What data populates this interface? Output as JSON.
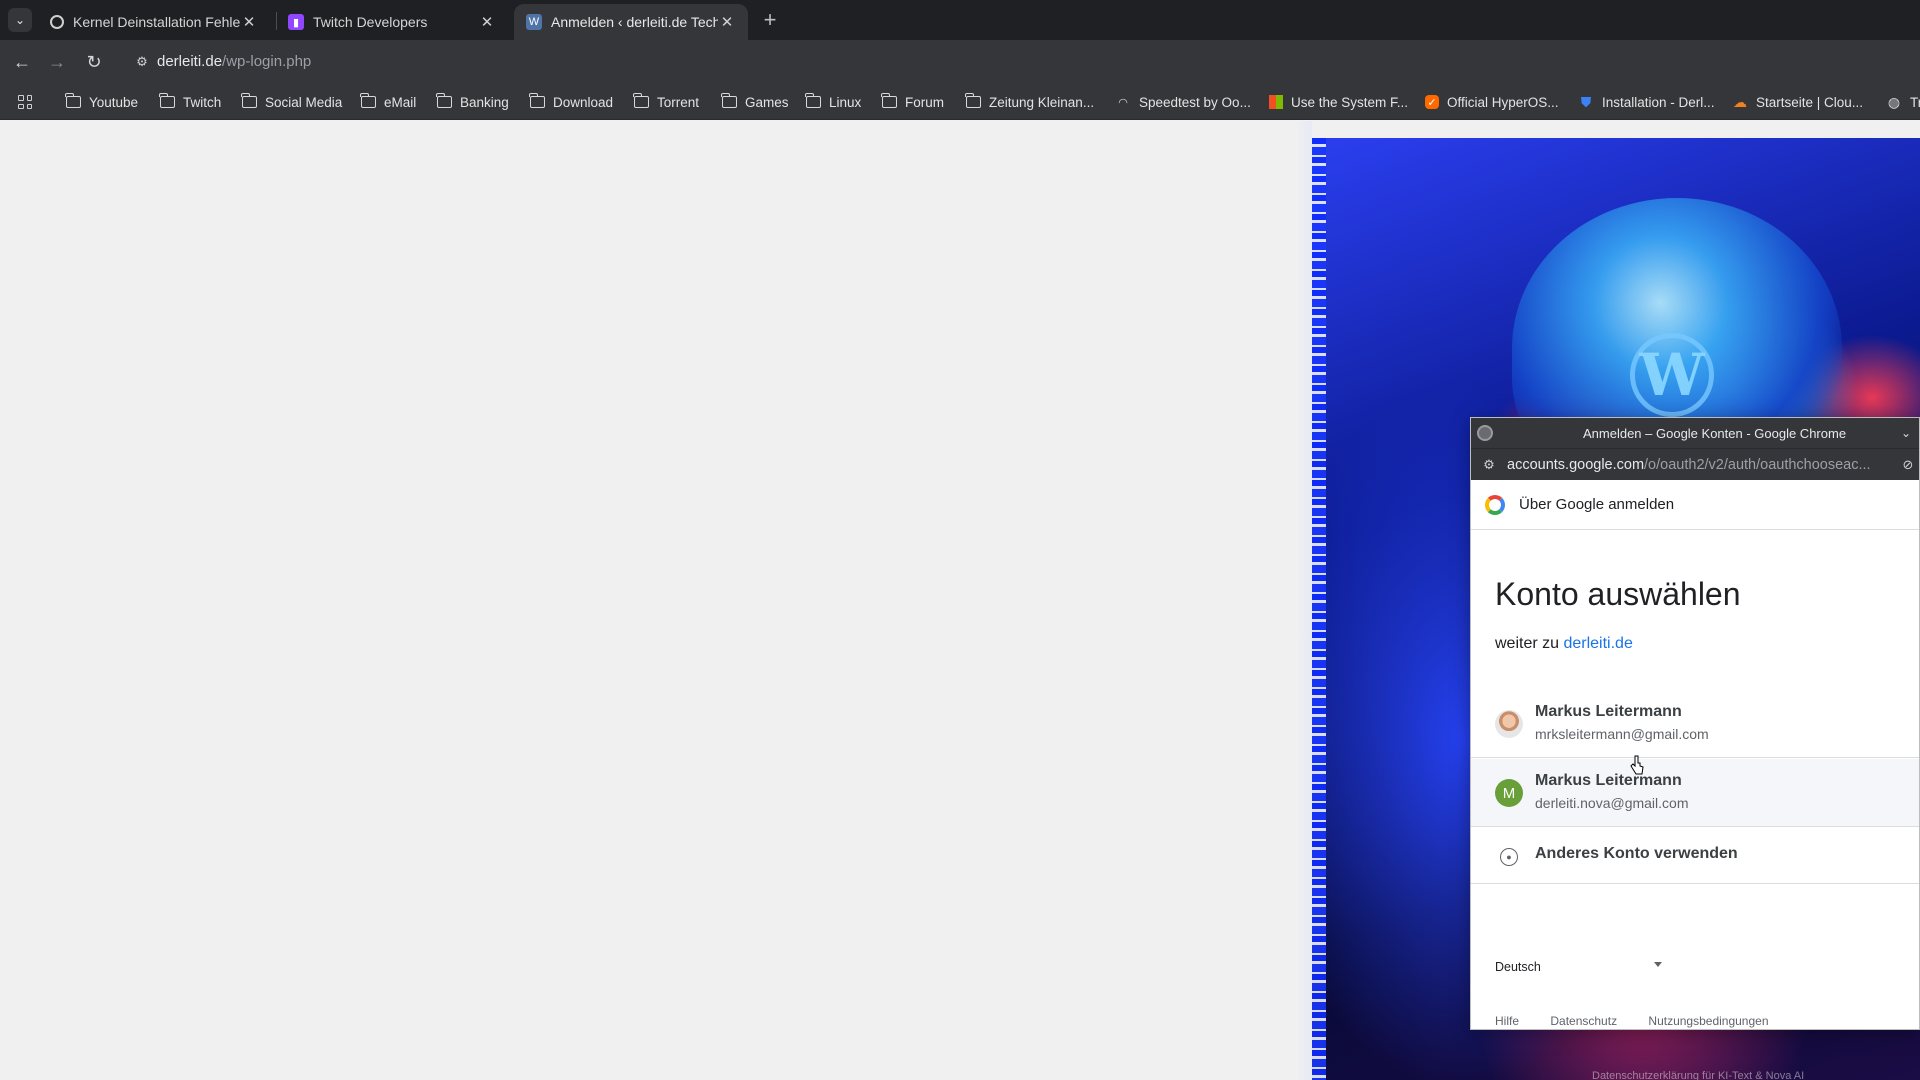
{
  "browser": {
    "tabs": [
      {
        "title": "Kernel Deinstallation Fehle",
        "favicon": "chromium-icon",
        "active": false
      },
      {
        "title": "Twitch Developers",
        "favicon": "twitch-icon",
        "active": false
      },
      {
        "title": "Anmelden ‹ derleiti.de Tech",
        "favicon": "wordpress-icon",
        "active": true
      }
    ],
    "url": {
      "host": "derleiti.de",
      "path": "/wp-login.php"
    },
    "bookmarks": [
      {
        "label": "Youtube",
        "icon": "folder-icon"
      },
      {
        "label": "Twitch",
        "icon": "folder-icon"
      },
      {
        "label": "Social Media",
        "icon": "folder-icon"
      },
      {
        "label": "eMail",
        "icon": "folder-icon"
      },
      {
        "label": "Banking",
        "icon": "folder-icon"
      },
      {
        "label": "Download",
        "icon": "folder-icon"
      },
      {
        "label": "Torrent",
        "icon": "folder-icon"
      },
      {
        "label": "Games",
        "icon": "folder-icon"
      },
      {
        "label": "Linux",
        "icon": "folder-icon"
      },
      {
        "label": "Forum",
        "icon": "folder-icon"
      },
      {
        "label": "Zeitung Kleinan...",
        "icon": "folder-icon"
      },
      {
        "label": "Speedtest by Oo...",
        "icon": "speedtest-icon"
      },
      {
        "label": "Use the System F...",
        "icon": "microsoft-icon"
      },
      {
        "label": "Official HyperOS...",
        "icon": "hyperos-icon"
      },
      {
        "label": "Installation - Derl...",
        "icon": "shield-icon"
      },
      {
        "label": "Startseite | Clou...",
        "icon": "cloudflare-icon"
      },
      {
        "label": "Tr",
        "icon": "globe-icon"
      }
    ]
  },
  "popup": {
    "window_title": "Anmelden – Google Konten - Google Chrome",
    "url": {
      "host": "accounts.google.com",
      "path": "/o/oauth2/v2/auth/oauthchooseac..."
    },
    "header": "Über Google anmelden",
    "heading": "Konto auswählen",
    "continue_prefix": "weiter zu ",
    "continue_link": "derleiti.de",
    "accounts": [
      {
        "name": "Markus Leitermann",
        "email": "mrksleitermann@gmail.com",
        "avatar": "photo",
        "initial": ""
      },
      {
        "name": "Markus Leitermann",
        "email": "derleiti.nova@gmail.com",
        "avatar": "letter",
        "initial": "M"
      }
    ],
    "other_account": "Anderes Konto verwenden",
    "language": "Deutsch",
    "footer": [
      "Hilfe",
      "Datenschutz",
      "Nutzungsbedingungen"
    ]
  },
  "page": {
    "footer_text": "Datenschutzerklärung für KI-Text & Nova AI"
  },
  "colors": {
    "chrome_dark": "#35363a",
    "link_blue": "#1a73e8",
    "avatar_green": "#689f38"
  }
}
